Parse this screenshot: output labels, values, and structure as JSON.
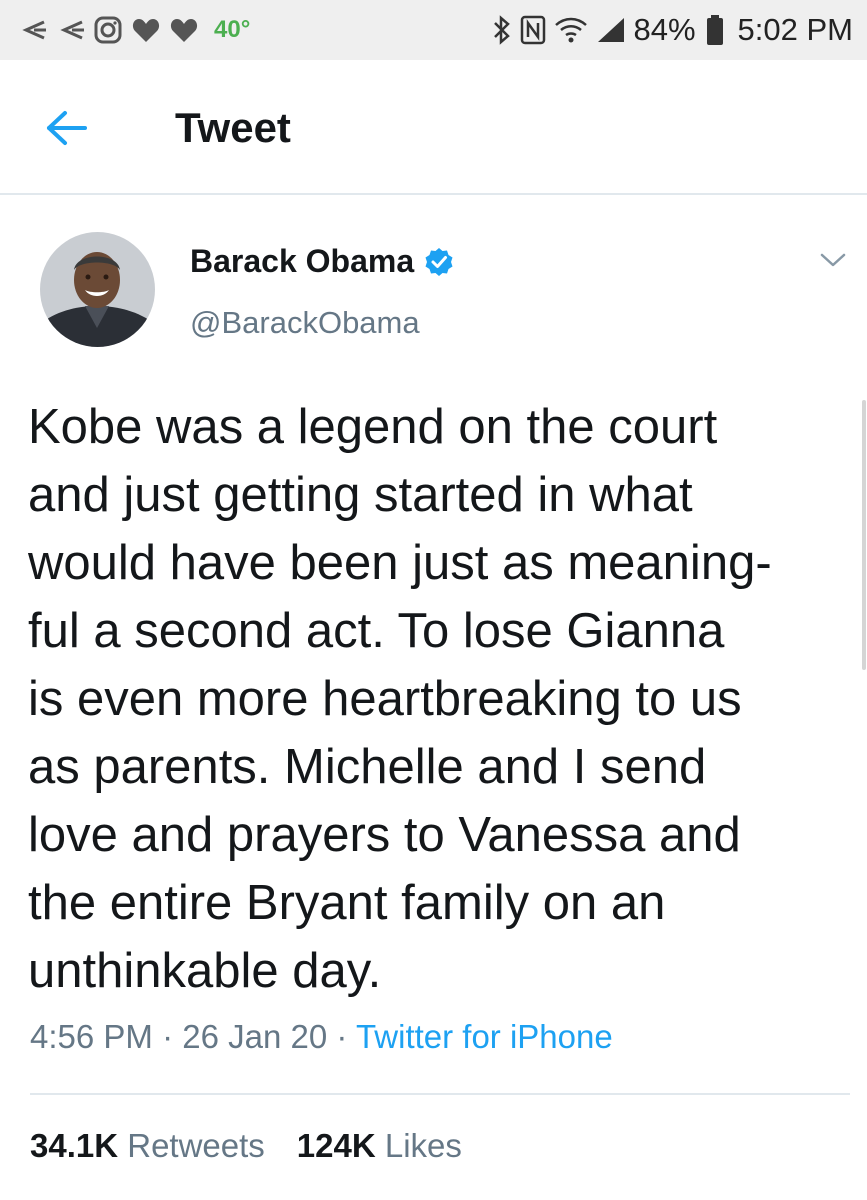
{
  "status_bar": {
    "temperature": "40°",
    "battery_percent": "84%",
    "time": "5:02 PM",
    "left_icons": [
      "arrow-icon",
      "arrow-icon",
      "instagram-icon",
      "heart-icon",
      "heart-icon"
    ],
    "right_icons": [
      "bluetooth-icon",
      "nfc-icon",
      "wifi-icon",
      "signal-icon",
      "battery-icon"
    ]
  },
  "header": {
    "title": "Tweet"
  },
  "tweet": {
    "author_name": "Barack Obama",
    "author_handle": "@BarackObama",
    "verified": true,
    "text_lines": [
      "Kobe was a legend on the court",
      "and just getting started in what",
      "would have been just as meaning-",
      "ful a second act. To lose Gianna",
      "is even more heartbreaking to us",
      "as parents. Michelle and I send",
      "love and prayers to Vanessa and",
      "the entire Bryant family on an",
      "unthinkable day."
    ],
    "time": "4:56 PM",
    "date": "26 Jan 20",
    "separator": " · ",
    "source": "Twitter for iPhone",
    "retweets_count": "34.1K",
    "retweets_label": "Retweets",
    "likes_count": "124K",
    "likes_label": "Likes"
  },
  "colors": {
    "accent": "#1da1f2",
    "secondary_text": "#657786",
    "temperature": "#4caf50"
  }
}
